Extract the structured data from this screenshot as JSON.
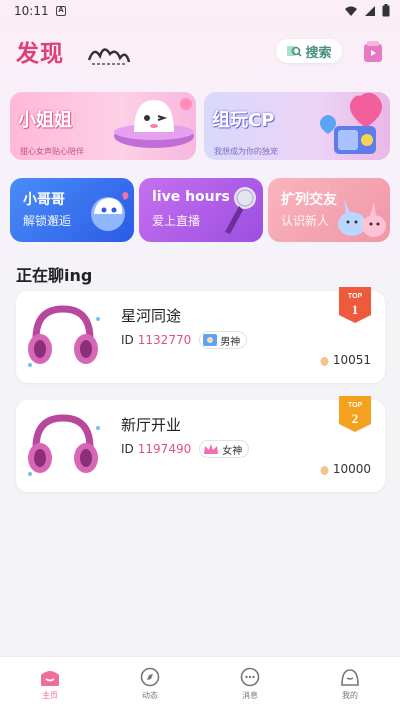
{
  "status_bar": {
    "time": "10:11",
    "app_icon": "A"
  },
  "header": {
    "title": "发现",
    "search_label": "搜索"
  },
  "banners": [
    {
      "title": "小姐姐",
      "subtitle": "甜心女声贴心陪伴"
    },
    {
      "title": "组玩CP",
      "subtitle": "我想成为你的独宠"
    }
  ],
  "categories": [
    {
      "title": "小哥哥",
      "subtitle": "解锁邂逅"
    },
    {
      "title": "live hours",
      "subtitle": "爱上直播"
    },
    {
      "title": "扩列交友",
      "subtitle": "认识新人"
    }
  ],
  "section_title": "正在聊ing",
  "rooms": [
    {
      "name": "星河同途",
      "id_label": "ID",
      "id": "1132770",
      "tag": "男神",
      "count": "10051",
      "rank_top": "TOP",
      "rank_num": "1"
    },
    {
      "name": "新厅开业",
      "id_label": "ID",
      "id": "1197490",
      "tag": "女神",
      "count": "10000",
      "rank_top": "TOP",
      "rank_num": "2"
    }
  ],
  "tabs": [
    {
      "label": "主页",
      "icon": "home-icon",
      "active": true
    },
    {
      "label": "动态",
      "icon": "compass-icon",
      "active": false
    },
    {
      "label": "消息",
      "icon": "chat-icon",
      "active": false
    },
    {
      "label": "我的",
      "icon": "profile-icon",
      "active": false
    }
  ],
  "colors": {
    "accent": "#e0407a",
    "id_pink": "#e0508a",
    "rank1": "#ee5b3c",
    "rank2": "#f4a11d",
    "tab_active": "#ef6d9a"
  }
}
